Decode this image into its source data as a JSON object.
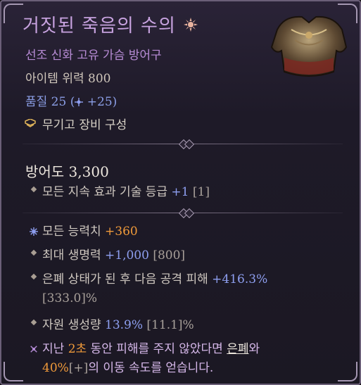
{
  "item": {
    "name": "거짓된 죽음의 수의",
    "subtitle": "선조 신화 고유 가슴 방어구",
    "power": "아이템 위력 800",
    "quality_prefix": "품질 25 (",
    "quality_bonus": "+25)",
    "loadout": "무기고 장비 구성",
    "armor": "방어도 3,300"
  },
  "implicit": {
    "text": "모든 지속 효과 기술 등급 ",
    "value": "+1",
    "range": " [1]"
  },
  "affixes": [
    {
      "label": "모든 능력치 ",
      "value": "+360",
      "range": ""
    },
    {
      "label": "최대 생명력 ",
      "value": "+1,000",
      "range": " [800]"
    },
    {
      "label": "은폐 상태가 된 후 다음 공격 피해 ",
      "value": "+416.3%",
      "range": " [333.0]%"
    },
    {
      "label": "자원 생성량 ",
      "value": "13.9%",
      "range": " [11.1]%"
    }
  ],
  "unique_power": {
    "part1": "지난 ",
    "seconds": "2초",
    "part2": " 동안 피해를 주지 않았다면 ",
    "keyword": "은폐",
    "part3": "와",
    "percent": "40%",
    "bracket": "[+]",
    "part4": "의 이동 속도를 얻습니다."
  },
  "colors": {
    "title": "#c7a2df",
    "affix_value": "#8e9ff0",
    "greater_affix": "#f09a3a",
    "unique_text": "#d6b8ea"
  },
  "icons": [
    "sun-rune-icon",
    "quality-star-icon",
    "loadout-icon",
    "diamond-bullet-icon",
    "greater-affix-star-icon",
    "unique-star-icon"
  ]
}
